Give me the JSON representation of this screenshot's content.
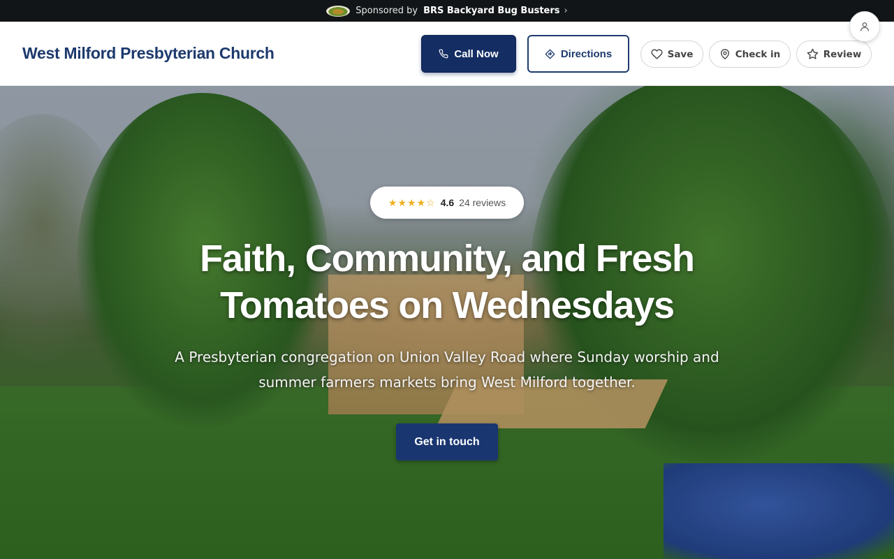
{
  "sponsor": {
    "prefix": "Sponsored by",
    "brand": "BRS Backyard Bug Busters",
    "chevron": "›",
    "logo_icon": "brs-logo-icon"
  },
  "header": {
    "title": "West Milford Presbyterian Church",
    "call_label": "Call Now",
    "directions_label": "Directions",
    "save_label": "Save",
    "checkin_label": "Check in",
    "review_label": "Review",
    "icons": [
      "phone-icon",
      "directions-icon",
      "heart-icon",
      "map-pin-icon",
      "star-icon",
      "user-icon"
    ]
  },
  "hero": {
    "rating": {
      "stars_text": "★★★★☆",
      "stars_value": 4.6,
      "score": "4.6",
      "reviews": "24 reviews"
    },
    "headline": "Faith, Community, and Fresh Tomatoes on Wednesdays",
    "subtext": "A Presbyterian congregation on Union Valley Road where Sunday worship and summer farmers markets bring West Milford together.",
    "cta_label": "Get in touch"
  },
  "colors": {
    "brand_navy": "#142d63",
    "title_navy": "#1d3a6e",
    "star_gold": "#f2b01e",
    "sponsor_bg": "#111517"
  }
}
